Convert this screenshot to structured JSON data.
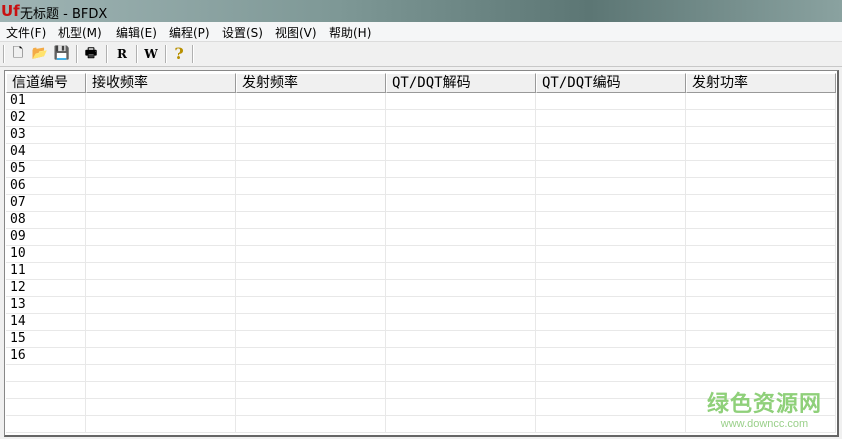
{
  "window": {
    "title": "无标题 - BFDX",
    "icon": "UF"
  },
  "menu": [
    "文件(F)",
    "机型(M)",
    "编辑(E)",
    "编程(P)",
    "设置(S)",
    "视图(V)",
    "帮助(H)"
  ],
  "toolbar": {
    "new": "new-file-icon",
    "open": "open-folder-icon",
    "save": "save-icon",
    "print": "print-icon",
    "read": "R",
    "write": "W",
    "help": "?"
  },
  "table": {
    "columns": [
      "信道编号",
      "接收频率",
      "发射频率",
      "QT/DQT解码",
      "QT/DQT编码",
      "发射功率"
    ],
    "rows": [
      "01",
      "02",
      "03",
      "04",
      "05",
      "06",
      "07",
      "08",
      "09",
      "10",
      "11",
      "12",
      "13",
      "14",
      "15",
      "16",
      "",
      "",
      "",
      ""
    ]
  },
  "watermark": {
    "title": "绿色资源网",
    "url": "www.downcc.com"
  }
}
